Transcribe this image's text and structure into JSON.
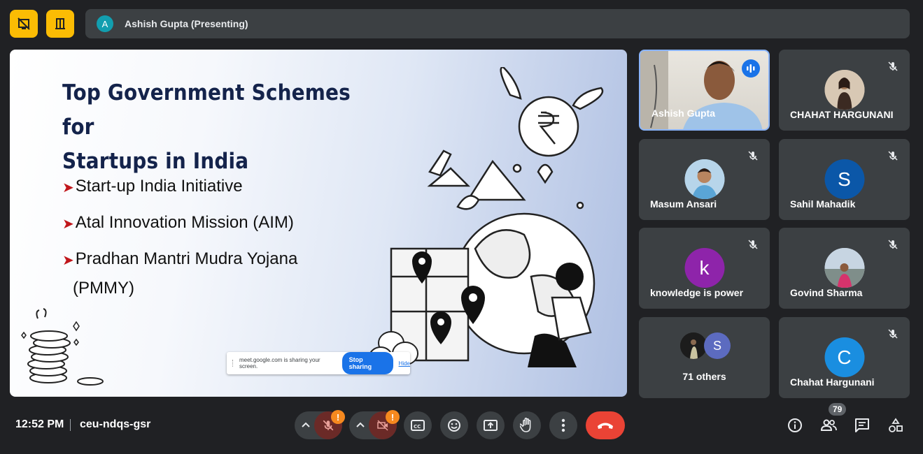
{
  "header": {
    "presenter_initial": "A",
    "presenter_label": "Ashish Gupta (Presenting)"
  },
  "slide": {
    "title_line1": "Top Government Schemes for",
    "title_line2": "Startups in India",
    "bullets": [
      "Start-up India Initiative",
      "Atal Innovation Mission (AIM)",
      "Pradhan Mantri Mudra Yojana"
    ],
    "bullet_continuation": "(PMMY)",
    "bullet_marker": "➤"
  },
  "share_notice": {
    "text": "meet.google.com is sharing your screen.",
    "stop_label": "Stop sharing",
    "hide_label": "Hide"
  },
  "participants": [
    {
      "name": "Ashish Gupta",
      "state": "speaking"
    },
    {
      "name": "CHAHAT HARGUNANI",
      "state": "muted"
    },
    {
      "name": "Masum Ansari",
      "state": "muted"
    },
    {
      "name": "Sahil Mahadik",
      "initial": "S",
      "color": "#0b57a8",
      "state": "muted"
    },
    {
      "name": "knowledge is power",
      "initial": "k",
      "color": "#8e24aa",
      "state": "muted"
    },
    {
      "name": "Govind Sharma",
      "state": "muted"
    },
    {
      "name": "71 others",
      "initial": "S",
      "color": "#5c6bc0"
    },
    {
      "name": "Chahat Hargunani",
      "initial": "C",
      "color": "#1a8ee0",
      "state": "muted"
    }
  ],
  "footer": {
    "time": "12:52 PM",
    "meeting_code": "ceu-ndqs-gsr",
    "warn_mark": "!",
    "participant_count": "79"
  },
  "colors": {
    "accent": "#fbbc04",
    "end_call": "#ea4335",
    "bg": "#202124",
    "tile": "#3c4043"
  }
}
